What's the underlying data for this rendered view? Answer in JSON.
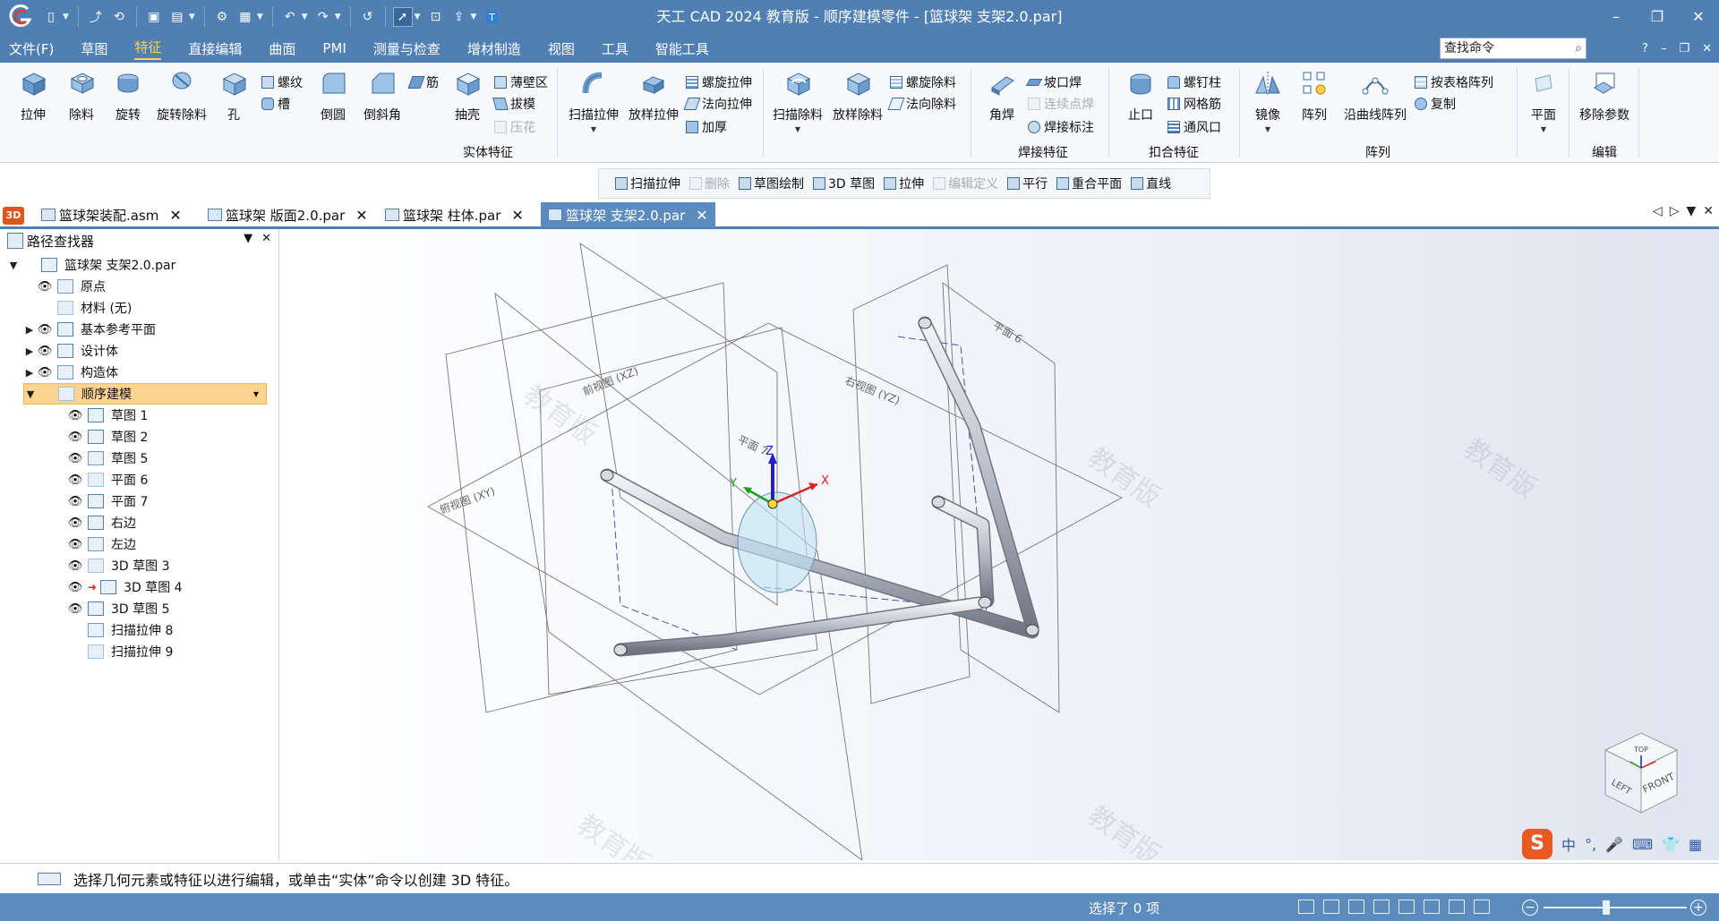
{
  "titlebar": {
    "title": "天工 CAD 2024 教育版 - 顺序建模零件 - [篮球架 支架2.0.par]",
    "minimize": "–",
    "restore": "❐",
    "close": "✕"
  },
  "menu": {
    "items": [
      "文件(F)",
      "草图",
      "特征",
      "直接编辑",
      "曲面",
      "PMI",
      "测量与检查",
      "增材制造",
      "视图",
      "工具",
      "智能工具"
    ],
    "active_index": 2,
    "search_placeholder": "查找命令",
    "help": "?",
    "min": "–",
    "restore": "❐",
    "close": "✕"
  },
  "ribbon": {
    "extrude": "拉伸",
    "cut": "除料",
    "revolve": "旋转",
    "revolve_cut": "旋转除料",
    "hole": "孔",
    "thread": "螺纹",
    "slot": "槽",
    "round": "倒圆",
    "chamfer": "倒斜角",
    "rib": "筋",
    "shell": "抽壳",
    "thin_region": "薄壁区",
    "draft": "拔模",
    "emboss": "压花",
    "group_solid": "实体特征",
    "sweep": "扫描拉伸",
    "loft": "放样拉伸",
    "helix": "螺旋拉伸",
    "normal": "法向拉伸",
    "thicken": "加厚",
    "sweep_cut": "扫描除料",
    "loft_cut": "放样除料",
    "helix_cut": "螺旋除料",
    "normal_cut": "法向除料",
    "fillet_weld": "角焊",
    "groove_weld": "坡口焊",
    "stitch_weld": "连续点焊",
    "weld_mark": "焊接标注",
    "group_weld": "焊接特征",
    "lip": "止口",
    "boss": "螺钉柱",
    "web": "网格筋",
    "vent": "通风口",
    "group_snap": "扣合特征",
    "mirror": "镜像",
    "pattern": "阵列",
    "curve_pattern": "沿曲线阵列",
    "table_pattern": "按表格阵列",
    "copy": "复制",
    "group_pattern": "阵列",
    "plane": "平面",
    "remove_params": "移除参数",
    "group_edit": "编辑"
  },
  "cmdbar": {
    "items": [
      {
        "label": "扫描拉伸",
        "disabled": false
      },
      {
        "label": "删除",
        "disabled": true
      },
      {
        "label": "草图绘制",
        "disabled": false
      },
      {
        "label": "3D 草图",
        "disabled": false
      },
      {
        "label": "拉伸",
        "disabled": false
      },
      {
        "label": "编辑定义",
        "disabled": true
      },
      {
        "label": "平行",
        "disabled": false
      },
      {
        "label": "重合平面",
        "disabled": false
      },
      {
        "label": "直线",
        "disabled": false
      }
    ]
  },
  "tabs": {
    "icon_3d": "3D",
    "docs": [
      "篮球架装配.asm",
      "篮球架 版面2.0.par",
      "篮球架 柱体.par",
      "篮球架 支架2.0.par"
    ],
    "active_index": 3,
    "close": "✕"
  },
  "pathfinder": {
    "title": "路径查找器",
    "tree": [
      {
        "label": "篮球架 支架2.0.par",
        "level": 0,
        "twisty": "▼",
        "eye": false
      },
      {
        "label": "原点",
        "level": 1,
        "twisty": "",
        "eye": true
      },
      {
        "label": "材料 (无)",
        "level": 1,
        "twisty": "",
        "eye": false
      },
      {
        "label": "基本参考平面",
        "level": 1,
        "twisty": "▶",
        "eye": true
      },
      {
        "label": "设计体",
        "level": 1,
        "twisty": "▶",
        "eye": true
      },
      {
        "label": "构造体",
        "level": 1,
        "twisty": "▶",
        "eye": true
      },
      {
        "label": "顺序建模",
        "level": 1,
        "twisty": "▼",
        "eye": false,
        "highlight": true
      },
      {
        "label": "草图 1",
        "level": 2,
        "twisty": "",
        "eye": true
      },
      {
        "label": "草图 2",
        "level": 2,
        "twisty": "",
        "eye": true
      },
      {
        "label": "草图 5",
        "level": 2,
        "twisty": "",
        "eye": true
      },
      {
        "label": "平面 6",
        "level": 2,
        "twisty": "",
        "eye": true
      },
      {
        "label": "平面 7",
        "level": 2,
        "twisty": "",
        "eye": true
      },
      {
        "label": "右边",
        "level": 2,
        "twisty": "",
        "eye": true
      },
      {
        "label": "左边",
        "level": 2,
        "twisty": "",
        "eye": true
      },
      {
        "label": "3D 草图 3",
        "level": 2,
        "twisty": "",
        "eye": true
      },
      {
        "label": "3D 草图 4",
        "level": 2,
        "twisty": "",
        "eye": true,
        "arrow": true
      },
      {
        "label": "3D 草图 5",
        "level": 2,
        "twisty": "",
        "eye": true
      },
      {
        "label": "扫描拉伸 8",
        "level": 2,
        "twisty": "",
        "eye": false
      },
      {
        "label": "扫描拉伸 9",
        "level": 2,
        "twisty": "",
        "eye": false
      }
    ]
  },
  "viewport": {
    "plane_front": "前视图 (XZ)",
    "plane_right": "右视图 (YZ)",
    "plane_top": "俯视图 (XY)",
    "plane6": "平面 6",
    "plane7": "平面 7",
    "axis_x": "X",
    "axis_y": "Y",
    "axis_z": "Z",
    "watermark": "教育版",
    "cube_top": "TOP",
    "cube_front": "FRONT",
    "cube_left": "LEFT"
  },
  "status": {
    "prompt": "选择几何元素或特征以进行编辑，或单击“实体”命令以创建 3D 特征。",
    "selected": "选择了 0 项",
    "zoom_minus": "−",
    "zoom_plus": "+"
  },
  "ime": {
    "logo": "S",
    "lang": "中",
    "punct": "°,",
    "mic": "🎤",
    "kbd": "⌨",
    "skin": "👕",
    "grid": "▦"
  },
  "colors": {
    "chrome": "#4f7fb3",
    "accent": "#ffd24a",
    "highlight_row": "#fbd58f",
    "axis_x": "#e02020",
    "axis_y": "#20a020",
    "axis_z": "#2020c0"
  }
}
